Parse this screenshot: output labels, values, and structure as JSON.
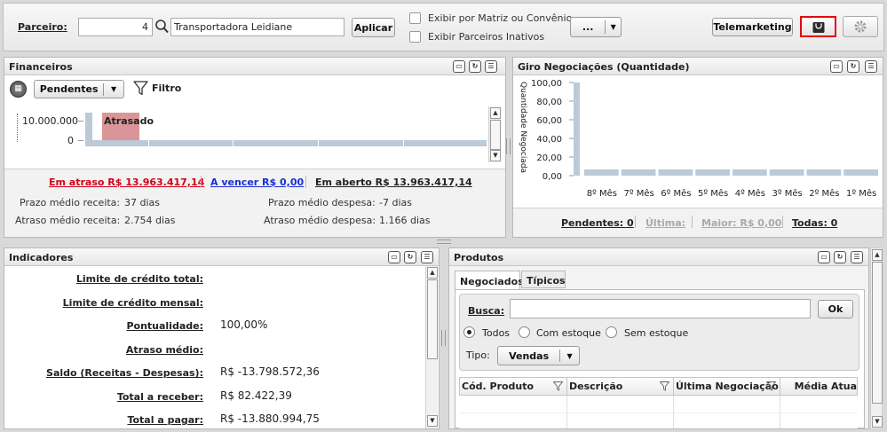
{
  "toolbar": {
    "parceiro_label": "Parceiro:",
    "parceiro_code": "4",
    "parceiro_name": "Transportadora Leidiane",
    "apply_label": "Aplicar",
    "check_matriz_label": "Exibir por Matriz ou Convênio",
    "check_inativos_label": "Exibir Parceiros Inativos",
    "more_label": "...",
    "telemarketing_label": "Telemarketing"
  },
  "financeiros": {
    "title": "Financeiros",
    "dropdown_value": "Pendentes",
    "filter_label": "Filtro",
    "y_tick_top": "10.000.000",
    "y_tick_zero": "0",
    "bar_label": "Atrasado",
    "em_atraso": "Em atraso R$ 13.963.417,14",
    "a_vencer": "A vencer R$ 0,00",
    "em_aberto": "Em aberto R$ 13.963.417,14",
    "prazo_receita_label": "Prazo médio receita:",
    "prazo_receita_value": "37 dias",
    "atraso_receita_label": "Atraso médio receita:",
    "atraso_receita_value": "2.754 dias",
    "prazo_despesa_label": "Prazo médio despesa:",
    "prazo_despesa_value": "-7 dias",
    "atraso_despesa_label": "Atraso médio despesa:",
    "atraso_despesa_value": "1.166 dias"
  },
  "giro": {
    "title": "Giro Negociações (Quantidade)",
    "y_axis_label": "Quantidade Negociada",
    "y_ticks": [
      "100,00",
      "80,00",
      "60,00",
      "40,00",
      "20,00",
      "0,00"
    ],
    "pendentes": "Pendentes: 0",
    "ultima": "Última:",
    "maior": "Maior: R$ 0,00",
    "todas": "Todas: 0"
  },
  "chart_data": {
    "type": "bar",
    "categories": [
      "8º Mês",
      "7º Mês",
      "6º Mês",
      "5º Mês",
      "4º Mês",
      "3º Mês",
      "2º Mês",
      "1º Mês"
    ],
    "series": [
      {
        "values": [
          0,
          0,
          0,
          0,
          0,
          0,
          0,
          0
        ]
      }
    ],
    "xlabel": "",
    "ylabel": "Quantidade Negociada",
    "ylim": [
      0,
      100
    ],
    "colors": {
      "bar": "#bccad8"
    }
  },
  "indicadores": {
    "title": "Indicadores",
    "rows": [
      {
        "label": "Limite de crédito total:",
        "value": ""
      },
      {
        "label": "Limite de crédito mensal:",
        "value": ""
      },
      {
        "label": "Pontualidade:",
        "value": "100,00%"
      },
      {
        "label": "Atraso médio:",
        "value": ""
      },
      {
        "label": "Saldo (Receitas - Despesas):",
        "value": "R$ -13.798.572,36"
      },
      {
        "label": "Total a receber:",
        "value": "R$ 82.422,39"
      },
      {
        "label": "Total a pagar:",
        "value": "R$ -13.880.994,75"
      }
    ]
  },
  "produtos": {
    "title": "Produtos",
    "tab_negociados": "Negociados",
    "tab_tipicos": "Típicos",
    "busca_label": "Busca:",
    "busca_value": "",
    "ok_label": "Ok",
    "radio_todos": "Todos",
    "radio_com": "Com estoque",
    "radio_sem": "Sem estoque",
    "tipo_label": "Tipo:",
    "tipo_value": "Vendas",
    "columns": [
      "Cód. Produto",
      "Descrição",
      "Última Negociação",
      "Média Atua"
    ]
  },
  "colors": {
    "highlight_border": "#e8000f",
    "atrasado_bar": "#d99597",
    "em_atraso_text": "#d0021b",
    "a_vencer_text": "#1a2ed6",
    "bars": "#bccad8"
  }
}
